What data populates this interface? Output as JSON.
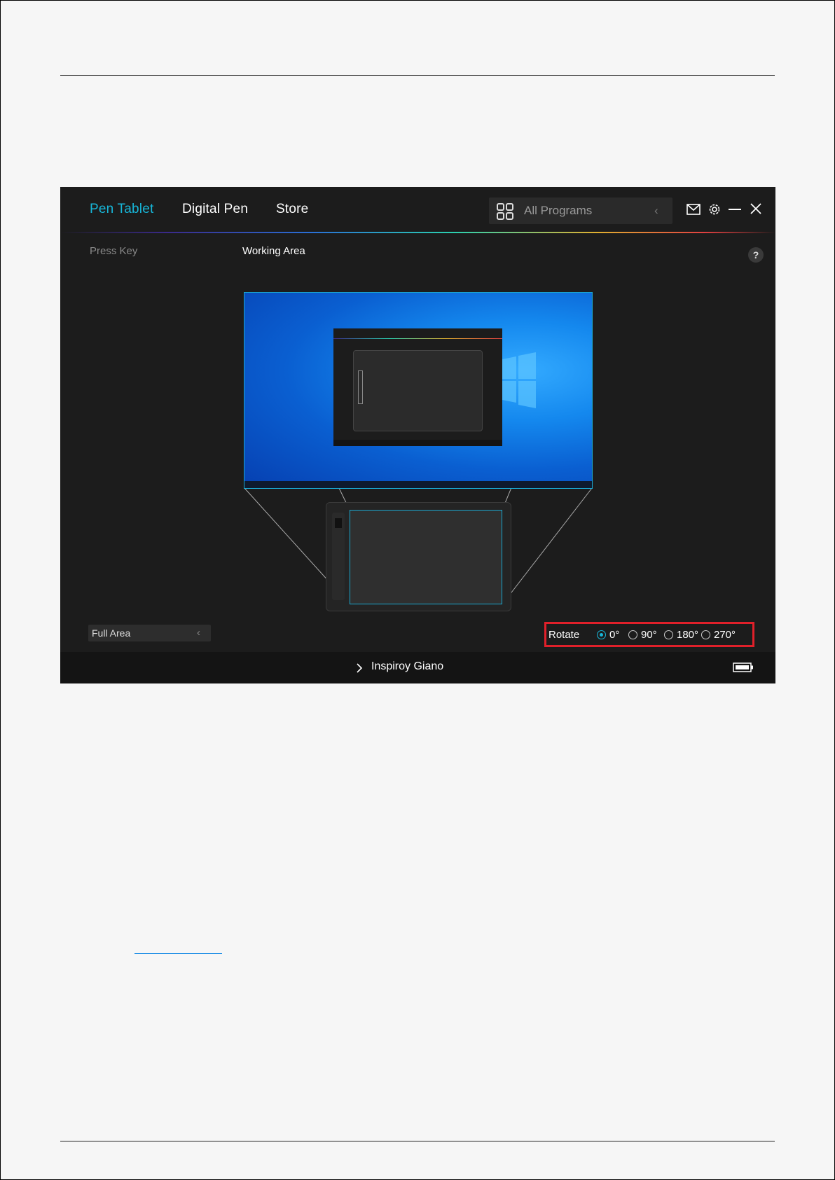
{
  "app": {
    "tabs": [
      {
        "label": "Pen Tablet",
        "active": true
      },
      {
        "label": "Digital Pen",
        "active": false
      },
      {
        "label": "Store",
        "active": false
      }
    ],
    "programs": {
      "label": "All Programs"
    },
    "subtabs": {
      "press_key": "Press Key",
      "working_area": "Working Area"
    },
    "help_label": "?",
    "area_select": {
      "value": "Full Area"
    },
    "rotate": {
      "label": "Rotate",
      "options": [
        "0°",
        "90°",
        "180°",
        "270°"
      ],
      "selected": "0°"
    },
    "device": {
      "name": "Inspiroy Giano"
    },
    "colors": {
      "accent": "#17b6d8",
      "highlight": "#e0202a",
      "background": "#1c1c1c"
    },
    "icons": [
      "grid-icon",
      "chevron-left-icon",
      "mail-icon",
      "gear-icon",
      "minimize-icon",
      "close-icon",
      "help-icon",
      "chevron-right-icon",
      "battery-icon"
    ]
  }
}
